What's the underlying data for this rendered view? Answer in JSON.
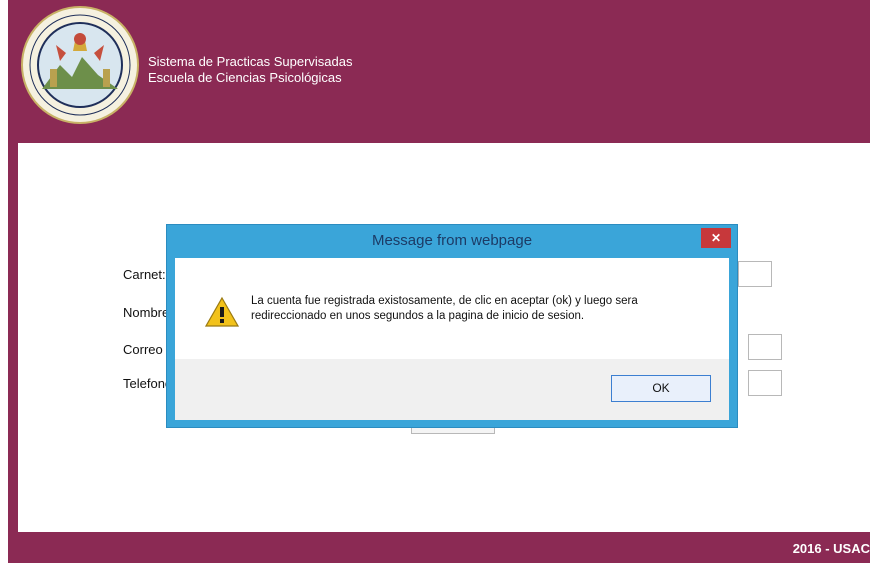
{
  "app": {
    "title_line1": "Sistema de Practicas Supervisadas",
    "title_line2": "Escuela de Ciencias Psicológicas",
    "seal_text": "CAROLINA ACADEMIA COACTEMALENSIS INTER CAETERAS ORBIS CONSPICUA"
  },
  "form": {
    "carnet_label": "Carnet:",
    "nombre_label": "Nombre",
    "correo_label": "Correo E",
    "telefono_label": "Telefono"
  },
  "footer": {
    "text": "2016 - USAC"
  },
  "dialog": {
    "title": "Message from webpage",
    "close_glyph": "✕",
    "message": "La cuenta fue registrada existosamente, de clic en aceptar (ok) y luego sera redireccionado en unos segundos a la pagina de inicio de sesion.",
    "ok_label": "OK",
    "icon": "warning-icon"
  },
  "colors": {
    "brand": "#8b2a54",
    "dialog_frame": "#3aa5d9",
    "close_button": "#c7383b",
    "ok_border": "#3c7fd1"
  }
}
